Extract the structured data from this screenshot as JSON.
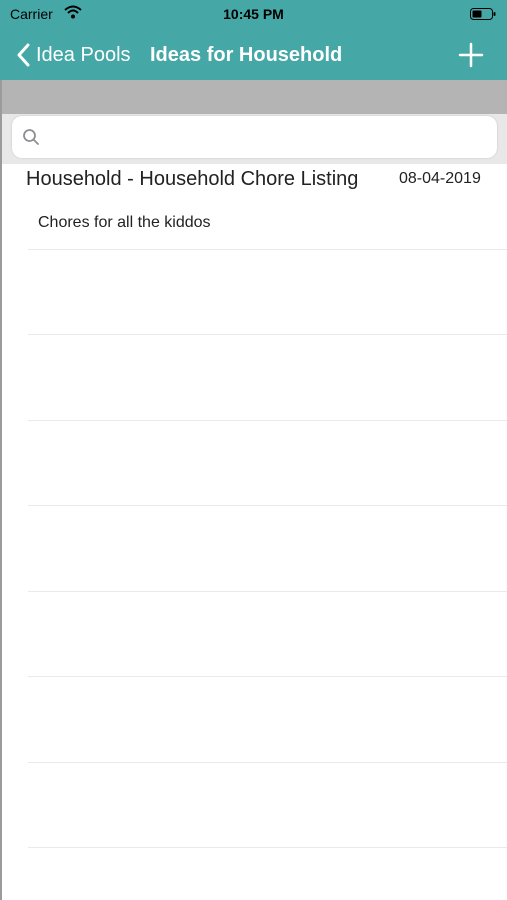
{
  "status_bar": {
    "carrier": "Carrier",
    "time": "10:45 PM",
    "icons": [
      "wifi-icon",
      "battery-icon"
    ]
  },
  "nav": {
    "back_label": "Idea Pools",
    "title": "Ideas for Household",
    "icons": [
      "chevron-left-icon",
      "plus-icon"
    ],
    "bar_color": "#45a8a6"
  },
  "search": {
    "placeholder": "",
    "value": ""
  },
  "list": {
    "items": [
      {
        "title": "Household - Household Chore Listing",
        "date": "08-04-2019",
        "subtitle": "Chores for all the kiddos"
      }
    ]
  }
}
